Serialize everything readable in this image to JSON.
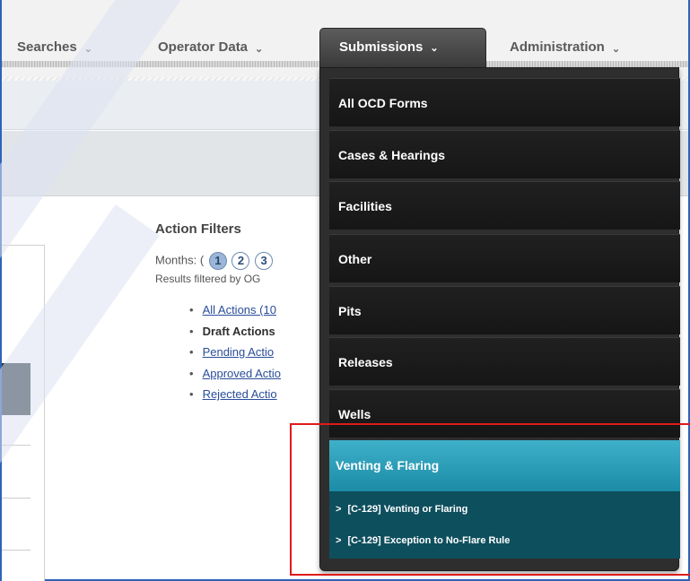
{
  "nav": {
    "items": [
      {
        "label": "Searches"
      },
      {
        "label": "Operator Data"
      },
      {
        "label": "Submissions"
      },
      {
        "label": "Administration"
      }
    ],
    "chevron": "⌄"
  },
  "filters": {
    "title": "Action Filters",
    "months_label": "Months: (",
    "months": [
      "1",
      "2",
      "3"
    ],
    "results_text": "Results filtered by OG",
    "actions": [
      {
        "label": "All Actions (10"
      },
      {
        "label": "Draft Actions"
      },
      {
        "label": "Pending Actio"
      },
      {
        "label": "Approved Actio"
      },
      {
        "label": "Rejected Actio"
      }
    ]
  },
  "dropdown": {
    "items": [
      {
        "label": "All OCD Forms"
      },
      {
        "label": "Cases & Hearings"
      },
      {
        "label": "Facilities"
      },
      {
        "label": "Other"
      },
      {
        "label": "Pits"
      },
      {
        "label": "Releases"
      },
      {
        "label": "Wells"
      }
    ],
    "active": {
      "label": "Venting & Flaring"
    },
    "subitems": [
      {
        "label": "[C-129] Venting or Flaring"
      },
      {
        "label": "[C-129] Exception to No-Flare Rule"
      }
    ]
  },
  "colors": {
    "accent": "#2a9fba",
    "highlight": "#e01a1a",
    "link": "#2a4d9a"
  }
}
